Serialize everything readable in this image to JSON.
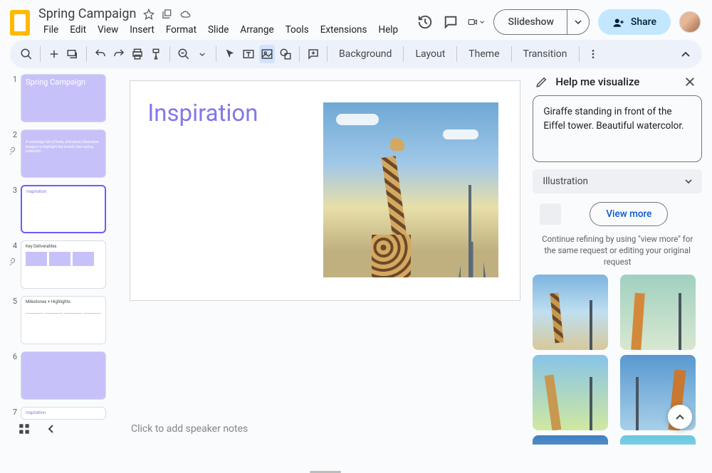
{
  "title": "Spring Campaign",
  "menu": [
    "File",
    "Edit",
    "View",
    "Insert",
    "Format",
    "Slide",
    "Arrange",
    "Tools",
    "Extensions",
    "Help"
  ],
  "header": {
    "slideshow": "Slideshow",
    "share": "Share"
  },
  "toolbar": {
    "background": "Background",
    "layout": "Layout",
    "theme": "Theme",
    "transition": "Transition"
  },
  "slides": [
    {
      "num": "1",
      "title": "Spring Campaign",
      "variant": "title-lavender"
    },
    {
      "num": "2",
      "title": "",
      "variant": "lavender-body",
      "body": "A campaign full of fresh, whimsical, illustrative imagery to highlight the brand's new spring collection."
    },
    {
      "num": "3",
      "title": "Inspiration",
      "variant": "selected"
    },
    {
      "num": "4",
      "title": "Key Deliverables",
      "variant": "kd"
    },
    {
      "num": "5",
      "title": "Milestones + Highlights",
      "variant": "mh"
    },
    {
      "num": "6",
      "title": "",
      "variant": "lavender-blank"
    },
    {
      "num": "7",
      "title": "Inspiration",
      "variant": "plain"
    }
  ],
  "canvas": {
    "title": "Inspiration"
  },
  "ai": {
    "title": "Help me visualize",
    "prompt": "Giraffe standing in front of the Eiffel tower. Beautiful watercolor.",
    "style": "Illustration",
    "view_more": "View more",
    "hint": "Continue refining by using \"view more\" for the same request or editing your original request"
  },
  "notes_placeholder": "Click to add speaker notes"
}
